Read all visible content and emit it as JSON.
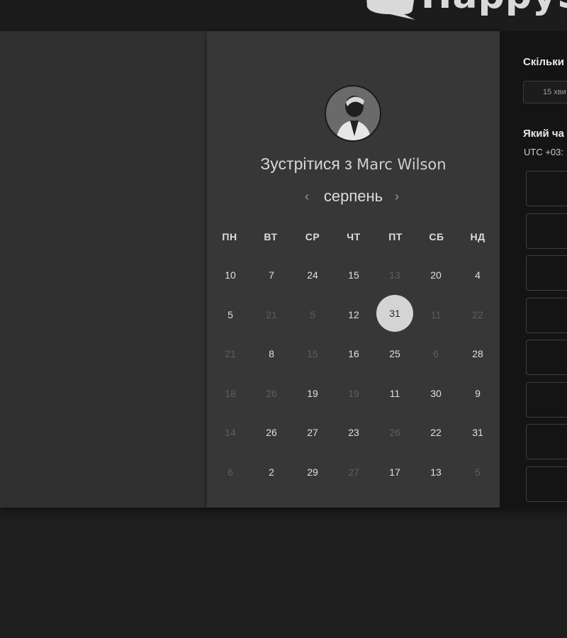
{
  "header": {
    "logo_text": "HappySig"
  },
  "booking": {
    "title_prefix": "Зустрітися з",
    "host_name": "Marc Wilson",
    "month": "серпень",
    "weekdays": [
      "ПН",
      "ВТ",
      "СР",
      "ЧТ",
      "ПТ",
      "СБ",
      "НД"
    ],
    "days": [
      [
        {
          "t": "10",
          "off": false
        },
        {
          "t": "7",
          "off": false
        },
        {
          "t": "24",
          "off": false
        },
        {
          "t": "15",
          "off": false
        },
        {
          "t": "13",
          "off": true
        },
        {
          "t": "20",
          "off": false
        },
        {
          "t": "4",
          "off": false
        }
      ],
      [
        {
          "t": "5",
          "off": false
        },
        {
          "t": "21",
          "off": true
        },
        {
          "t": "5",
          "off": true
        },
        {
          "t": "12",
          "off": false
        },
        {
          "t": "31",
          "off": false,
          "selected": true
        },
        {
          "t": "11",
          "off": true
        },
        {
          "t": "22",
          "off": true
        }
      ],
      [
        {
          "t": "21",
          "off": true
        },
        {
          "t": "8",
          "off": false
        },
        {
          "t": "15",
          "off": true
        },
        {
          "t": "16",
          "off": false
        },
        {
          "t": "25",
          "off": false
        },
        {
          "t": "6",
          "off": true
        },
        {
          "t": "28",
          "off": false
        }
      ],
      [
        {
          "t": "18",
          "off": true
        },
        {
          "t": "26",
          "off": true
        },
        {
          "t": "19",
          "off": false
        },
        {
          "t": "19",
          "off": true
        },
        {
          "t": "11",
          "off": false
        },
        {
          "t": "30",
          "off": false
        },
        {
          "t": "9",
          "off": false
        }
      ],
      [
        {
          "t": "14",
          "off": true
        },
        {
          "t": "26",
          "off": false
        },
        {
          "t": "27",
          "off": false
        },
        {
          "t": "23",
          "off": false
        },
        {
          "t": "26",
          "off": true
        },
        {
          "t": "22",
          "off": false
        },
        {
          "t": "31",
          "off": false
        }
      ],
      [
        {
          "t": "6",
          "off": true
        },
        {
          "t": "2",
          "off": false
        },
        {
          "t": "29",
          "off": false
        },
        {
          "t": "27",
          "off": true
        },
        {
          "t": "17",
          "off": false
        },
        {
          "t": "13",
          "off": false
        },
        {
          "t": "5",
          "off": true
        }
      ]
    ]
  },
  "side": {
    "duration_label": "Скільки",
    "duration_value": "15 хви",
    "time_label": "Який ча",
    "timezone": "UTC +03:"
  }
}
